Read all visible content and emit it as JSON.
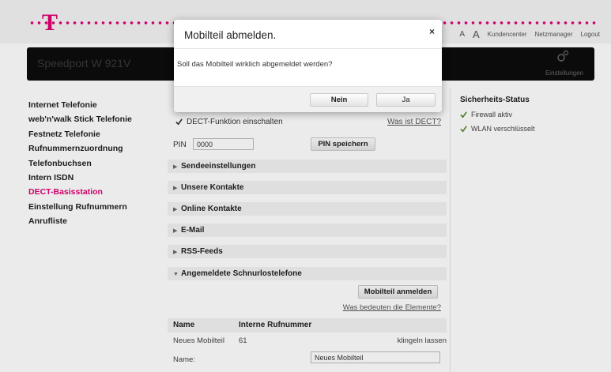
{
  "brand": {
    "logo_char": "·T·",
    "product": "Speedport W 921V",
    "accent_color": "#e20074"
  },
  "topnav": {
    "font_small": "A",
    "font_big": "A",
    "links": [
      "Kundencenter",
      "Netzmanager",
      "Logout"
    ]
  },
  "header": {
    "settings_label": "Einstellungen",
    "settings_icon": "settings-icon"
  },
  "sidebar": {
    "items": [
      {
        "label": "Internet Telefonie",
        "active": false
      },
      {
        "label": "web'n'walk Stick Telefonie",
        "active": false
      },
      {
        "label": "Festnetz Telefonie",
        "active": false
      },
      {
        "label": "Rufnummernzuordnung",
        "active": false
      },
      {
        "label": "Telefonbuchsen",
        "active": false
      },
      {
        "label": "Intern ISDN",
        "active": false
      },
      {
        "label": "DECT-Basisstation",
        "active": true
      },
      {
        "label": "Einstellung Rufnummern",
        "active": false
      },
      {
        "label": "Anrufliste",
        "active": false
      }
    ]
  },
  "security": {
    "title": "Sicherheits-Status",
    "items": [
      "Firewall aktiv",
      "WLAN verschlüsselt"
    ]
  },
  "main": {
    "dect_checkbox_label": "DECT-Funktion einschalten",
    "dect_checked": true,
    "dect_link": "Was ist DECT?",
    "pin_label": "PIN",
    "pin_value": "0000",
    "pin_button": "PIN speichern",
    "sections": [
      {
        "label": "Sendeeinstellungen",
        "expanded": false
      },
      {
        "label": "Unsere Kontakte",
        "expanded": false
      },
      {
        "label": "Online Kontakte",
        "expanded": false
      },
      {
        "label": "E-Mail",
        "expanded": false
      },
      {
        "label": "RSS-Feeds",
        "expanded": false
      },
      {
        "label": "Angemeldete Schnurlostelefone",
        "expanded": true
      }
    ],
    "register_button": "Mobilteil anmelden",
    "elements_link": "Was bedeuten die Elemente?",
    "table": {
      "headers": [
        "Name",
        "Interne Rufnummer"
      ],
      "rows": [
        {
          "name": "Neues Mobilteil",
          "number": "61",
          "action": "klingeln lassen"
        }
      ]
    },
    "name_label": "Name:",
    "name_value": "Neues Mobilteil"
  },
  "modal": {
    "title": "Mobilteil abmelden.",
    "close": "×",
    "text": "Soll das Mobilteil wirklich abgemeldet werden?",
    "no_button": "Nein",
    "yes_button": "Ja"
  }
}
